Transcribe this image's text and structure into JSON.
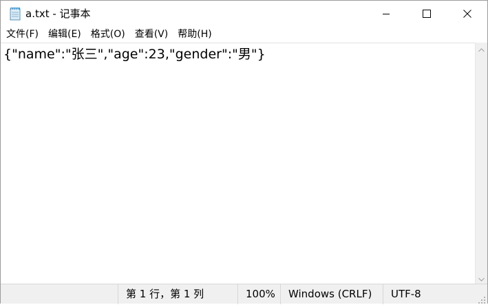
{
  "window": {
    "title": "a.txt - 记事本",
    "app_icon": "notepad-icon",
    "controls": [
      "minimize-icon",
      "maximize-icon",
      "close-icon"
    ]
  },
  "menu": {
    "items": [
      {
        "label": "文件(F)"
      },
      {
        "label": "编辑(E)"
      },
      {
        "label": "格式(O)"
      },
      {
        "label": "查看(V)"
      },
      {
        "label": "帮助(H)"
      }
    ]
  },
  "editor": {
    "content": "{\"name\":\"张三\",\"age\":23,\"gender\":\"男\"}"
  },
  "statusbar": {
    "position": "第 1 行，第 1 列",
    "zoom": "100%",
    "line_ending": "Windows (CRLF)",
    "encoding": "UTF-8"
  },
  "colors": {
    "background": "#ffffff",
    "statusbar_bg": "#f0f0f0",
    "text": "#000000"
  }
}
